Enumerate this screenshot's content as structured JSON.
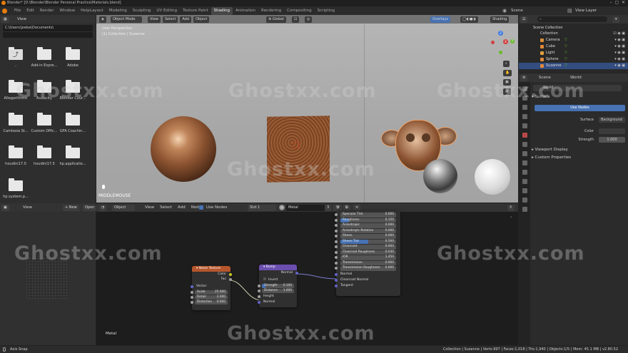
{
  "title_bar": {
    "title": "Blender* [D:\\Blender\\Blender Personal Practice\\Materials.blend]",
    "menus": [
      "File",
      "Edit",
      "Render",
      "Window",
      "Help"
    ],
    "workspaces": [
      "Layout",
      "Modeling",
      "Sculpting",
      "UV Editing",
      "Texture Paint",
      "Shading",
      "Animation",
      "Rendering",
      "Compositing",
      "Scripting"
    ],
    "active_workspace": "Shading",
    "scene": "Scene",
    "view_layer": "View Layer"
  },
  "file_browser": {
    "view_label": "View",
    "path": "C:\\Users\\joeba\\Documents\\",
    "items": [
      {
        "label": "..",
        "parent": true
      },
      {
        "label": "Add-in Expre..."
      },
      {
        "label": "Adobe"
      },
      {
        "label": "Allegorithmic"
      },
      {
        "label": "Audacity"
      },
      {
        "label": "Blender Cour..."
      },
      {
        "label": "Camtasia St..."
      },
      {
        "label": "Custom Offic..."
      },
      {
        "label": "GFA Coachin..."
      },
      {
        "label": "houdini17.0"
      },
      {
        "label": "houdini17.5"
      },
      {
        "label": "hp.applicatio..."
      },
      {
        "label": "hp.system.p..."
      }
    ]
  },
  "viewport": {
    "mode": "Object Mode",
    "menus": [
      "View",
      "Select",
      "Add",
      "Object"
    ],
    "orientation": "Global",
    "overlays": "Overlays",
    "shading": "Shading",
    "perspective_label": "User Perspective",
    "collection_label": "(1) Collection | Suzanne",
    "status_text": "MIDDLEMOUSE",
    "gizmo": {
      "z": "Z",
      "x": "X",
      "y": "Y"
    }
  },
  "outliner": {
    "root": "Scene Collection",
    "collection": "Collection",
    "objects": [
      "Camera",
      "Cube",
      "Light",
      "Sphere",
      "Suzanne"
    ]
  },
  "properties": {
    "tabs": [
      "Scene",
      "World"
    ],
    "world_name": "World",
    "panel_surface": "Surface",
    "use_nodes": "Use Nodes",
    "surface_label": "Surface",
    "surface_value": "Background",
    "color_label": "Color",
    "strength_label": "Strength",
    "strength_value": "1.000",
    "panel_viewport": "Viewport Display",
    "panel_custom": "Custom Properties"
  },
  "image_editor": {
    "view_label": "View",
    "new_label": "New",
    "open_label": "Open"
  },
  "node_editor": {
    "object_label": "Object",
    "menus": [
      "View",
      "Select",
      "Add",
      "Node"
    ],
    "use_nodes_label": "Use Nodes",
    "slot": "Slot 1",
    "material": "Metal",
    "user_count": "3",
    "footer_label": "Metal",
    "noise_node": {
      "title": "Noise Texture",
      "outputs": [
        "Color",
        "Fac"
      ],
      "vector": "Vector",
      "fields": [
        {
          "label": "Scale",
          "value": "25.000"
        },
        {
          "label": "Detail",
          "value": "2.000"
        },
        {
          "label": "Distortion",
          "value": "0.000"
        }
      ]
    },
    "bump_node": {
      "title": "Bump",
      "output": "Normal",
      "invert": "Invert",
      "fields": [
        {
          "label": "Strength",
          "value": "0.100"
        },
        {
          "label": "Distance",
          "value": "1.000"
        }
      ],
      "inputs": [
        "Height",
        "Normal"
      ]
    },
    "bsdf_node": {
      "fields": [
        {
          "label": "Specular Tint",
          "value": "0.000"
        },
        {
          "label": "Roughness",
          "value": "0.150"
        },
        {
          "label": "Anisotropic",
          "value": "0.000"
        },
        {
          "label": "Anisotropic Rotation",
          "value": "0.000"
        },
        {
          "label": "Sheen",
          "value": "0.000"
        },
        {
          "label": "Sheen Tint",
          "value": "0.500"
        },
        {
          "label": "Clearcoat",
          "value": "0.000"
        },
        {
          "label": "Clearcoat Roughness",
          "value": "0.030"
        },
        {
          "label": "IOR",
          "value": "1.450"
        },
        {
          "label": "Transmission",
          "value": "0.000"
        },
        {
          "label": "Transmission Roughness",
          "value": "0.000"
        }
      ],
      "sockets": [
        "Normal",
        "Clearcoat Normal",
        "Tangent"
      ]
    }
  },
  "status_bar": {
    "left": "Axis Snap",
    "right": "Collection | Suzanne | Verts:997 | Faces:1,018 | Tris:1,940 | Objects:1/5 | Mem: 45.1 MB | v2.80.52"
  },
  "watermark": "Ghostxx.com",
  "colors": {
    "accent": "#4772b3",
    "noise_header": "#b5562c",
    "bump_header": "#6b4fb0",
    "wire": "#c8c8a8"
  }
}
